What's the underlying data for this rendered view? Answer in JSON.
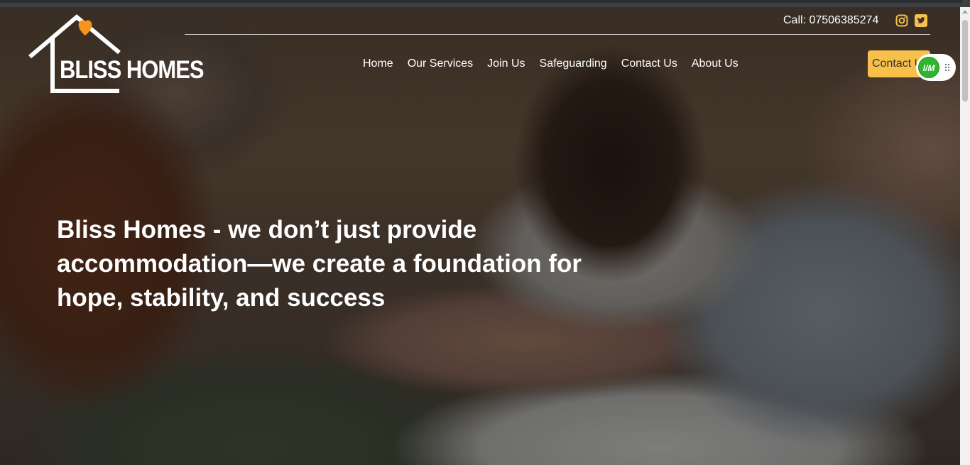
{
  "brand": {
    "logo_text": "BLISS HOMES",
    "heart_color": "#f7941d"
  },
  "header": {
    "call_text": "Call: 07506385274",
    "social": [
      {
        "icon": "instagram-icon",
        "color": "#f7c04a"
      },
      {
        "icon": "twitter-icon",
        "color": "#f7c04a"
      }
    ]
  },
  "nav": {
    "items": [
      "Home",
      "Our Services",
      "Join Us",
      "Safeguarding",
      "Contact Us",
      "About Us"
    ]
  },
  "cta": {
    "label": "Contact Us",
    "color": "#f7c04a"
  },
  "widget": {
    "badge_text": "I/M",
    "color": "#2fb62f"
  },
  "hero": {
    "title": "Bliss Homes - we don’t just provide accommodation—we create a foundation for hope, stability, and success"
  }
}
